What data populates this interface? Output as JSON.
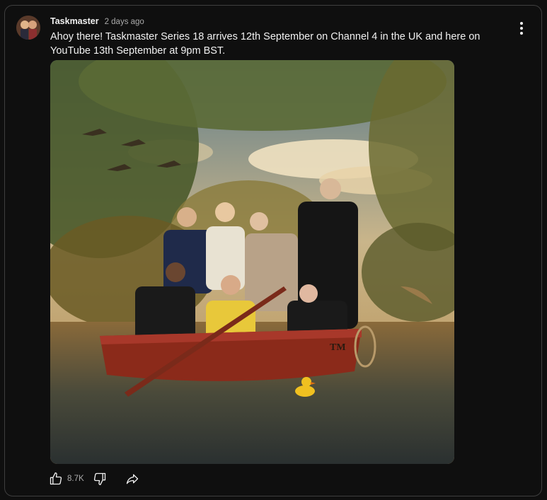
{
  "post": {
    "channel_name": "Taskmaster",
    "posted_time": "2 days ago",
    "body_text": "Ahoy there! Taskmaster Series 18 arrives 12th September on Channel 4 in the UK and here on YouTube 13th September at 9pm BST.",
    "image": {
      "boat_label": "TM"
    }
  },
  "actions": {
    "like_count": "8.7K",
    "icons": [
      "thumbs-up-icon",
      "thumbs-down-icon",
      "share-icon",
      "more-vert-icon"
    ]
  }
}
